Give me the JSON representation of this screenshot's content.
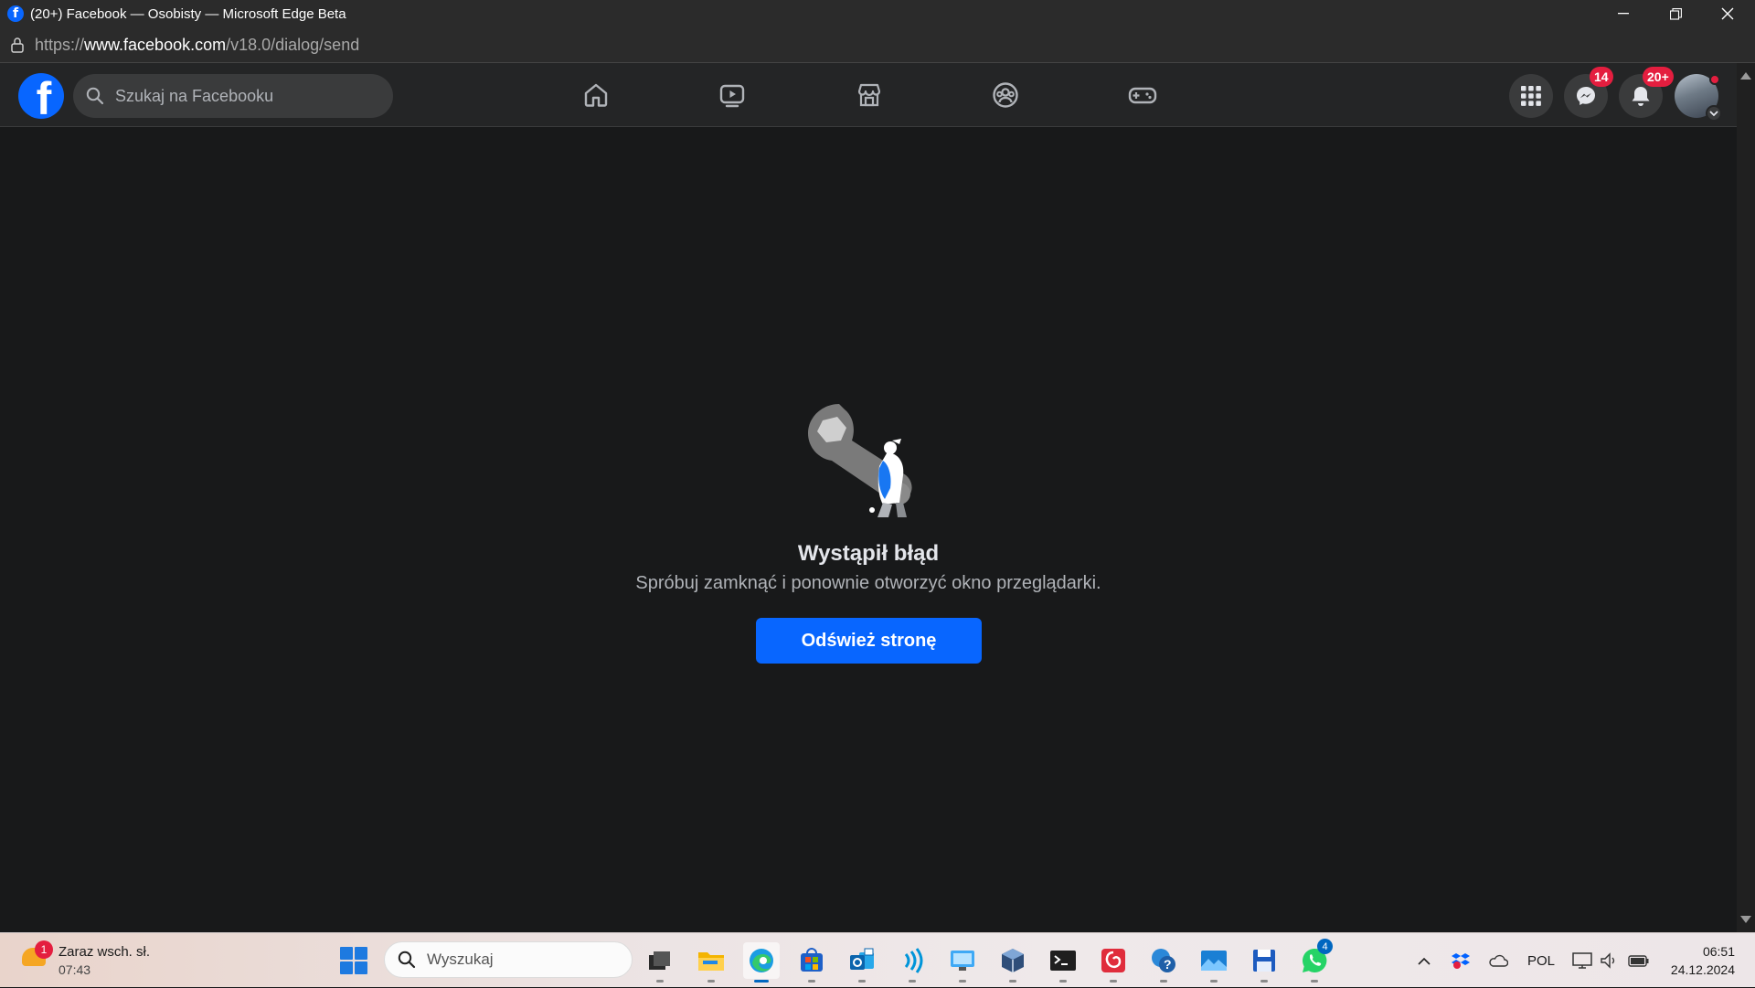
{
  "window": {
    "title": "(20+) Facebook — Osobisty — Microsoft Edge Beta"
  },
  "address": {
    "scheme": "https://",
    "host": "www.facebook.com",
    "path": "/v18.0/dialog/send"
  },
  "header": {
    "search_placeholder": "Szukaj na Facebooku",
    "nav_tabs": [
      "home",
      "watch",
      "marketplace",
      "groups",
      "gaming"
    ],
    "messenger_badge": "14",
    "notifications_badge": "20+",
    "brand_color": "#0866ff",
    "badge_color": "#e41e3f"
  },
  "error": {
    "title": "Wystąpił błąd",
    "description": "Spróbuj zamknąć i ponownie otworzyć okno przeglądarki.",
    "button_label": "Odśwież stronę"
  },
  "taskbar": {
    "weather_title": "Zaraz wsch. sł.",
    "weather_time": "07:43",
    "weather_badge": "1",
    "search_placeholder": "Wyszukaj",
    "apps": [
      "task-view",
      "file-explorer",
      "edge",
      "store",
      "outlook",
      "audio-app",
      "remote-desktop",
      "virtualbox",
      "terminal",
      "pdf-reader",
      "help",
      "photos",
      "save-app",
      "whatsapp"
    ],
    "whatsapp_badge": "4",
    "language": "POL",
    "time": "06:51",
    "date": "24.12.2024"
  }
}
